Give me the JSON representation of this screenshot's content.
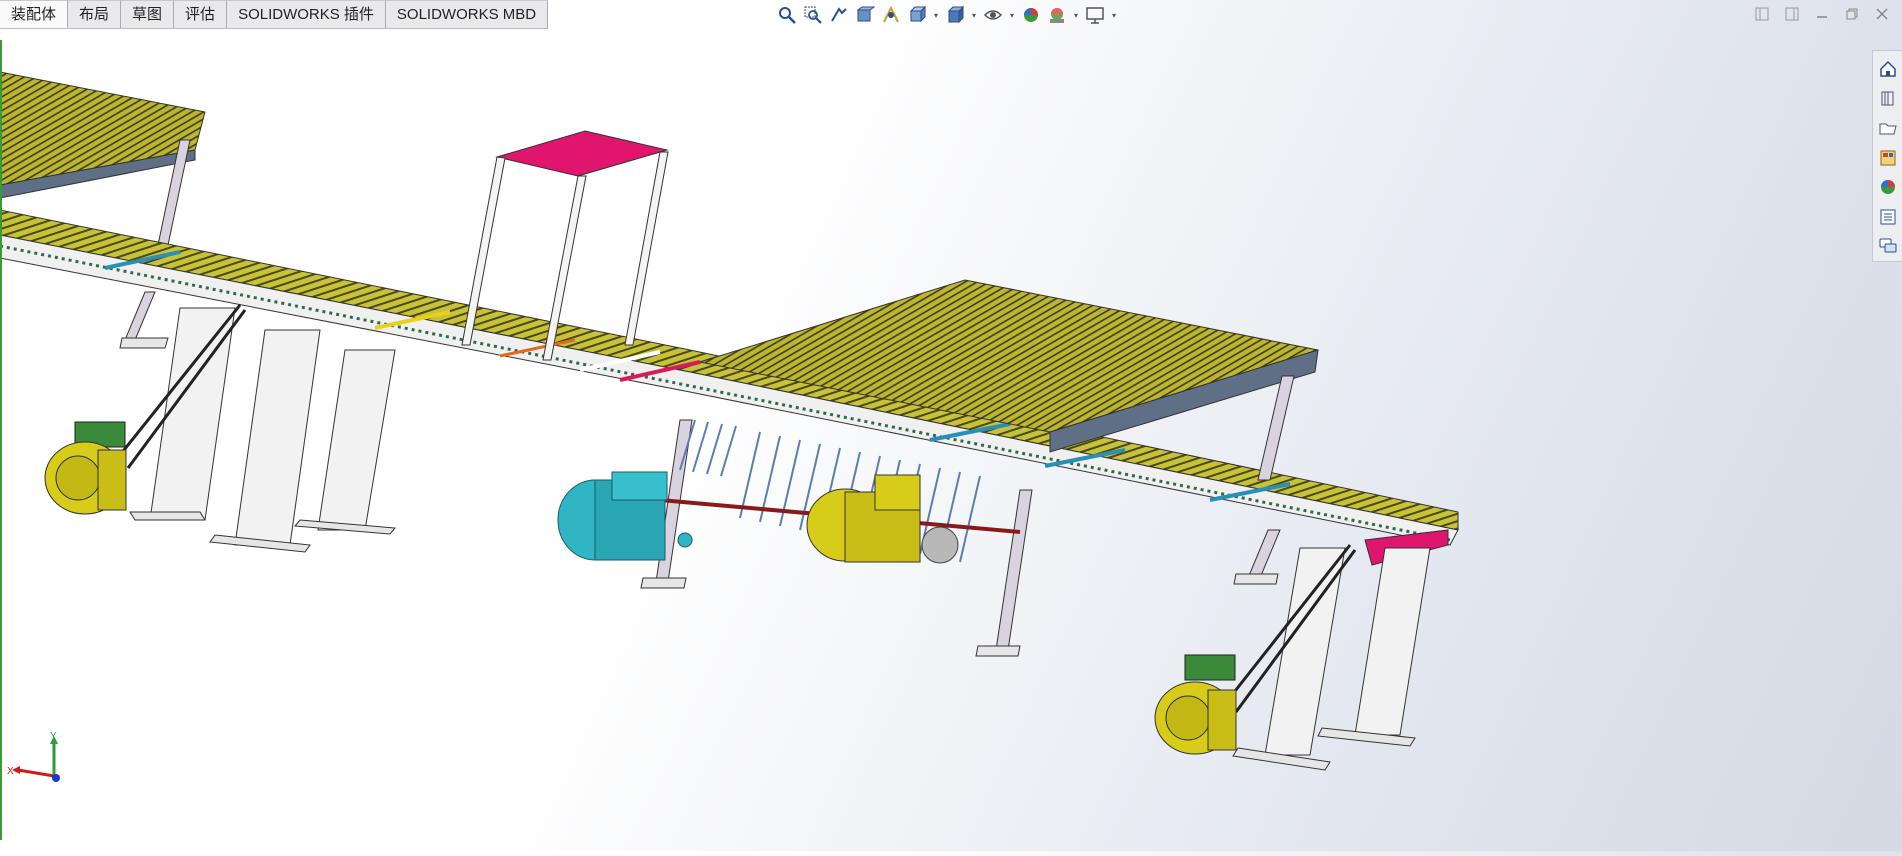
{
  "tabs": [
    {
      "label": "装配体",
      "active": true
    },
    {
      "label": "布局",
      "active": false
    },
    {
      "label": "草图",
      "active": false
    },
    {
      "label": "评估",
      "active": false
    },
    {
      "label": "SOLIDWORKS 插件",
      "active": false
    },
    {
      "label": "SOLIDWORKS MBD",
      "active": false
    }
  ],
  "headsup_icons": [
    "zoom-to-fit-icon",
    "zoom-to-area-icon",
    "previous-view-icon",
    "section-view-icon",
    "dynamic-annotation-icon",
    "view-orientation-icon",
    "display-style-icon",
    "hide-show-items-icon",
    "edit-appearance-icon",
    "apply-scene-icon",
    "view-settings-icon"
  ],
  "taskpane_icons": [
    "home-icon",
    "design-library-icon",
    "file-explorer-icon",
    "view-palette-icon",
    "appearances-icon",
    "custom-properties-icon",
    "forum-icon"
  ],
  "triad": {
    "x_label": "X",
    "y_label": "Y"
  },
  "colors": {
    "roller_yellow": "#c8c23a",
    "frame_white": "#f2f2f2",
    "hopper_magenta": "#e0166e",
    "motor_cyan": "#2fb5c4",
    "motor_yellow": "#d8cc1a",
    "accent_blue": "#2a8fb8"
  }
}
